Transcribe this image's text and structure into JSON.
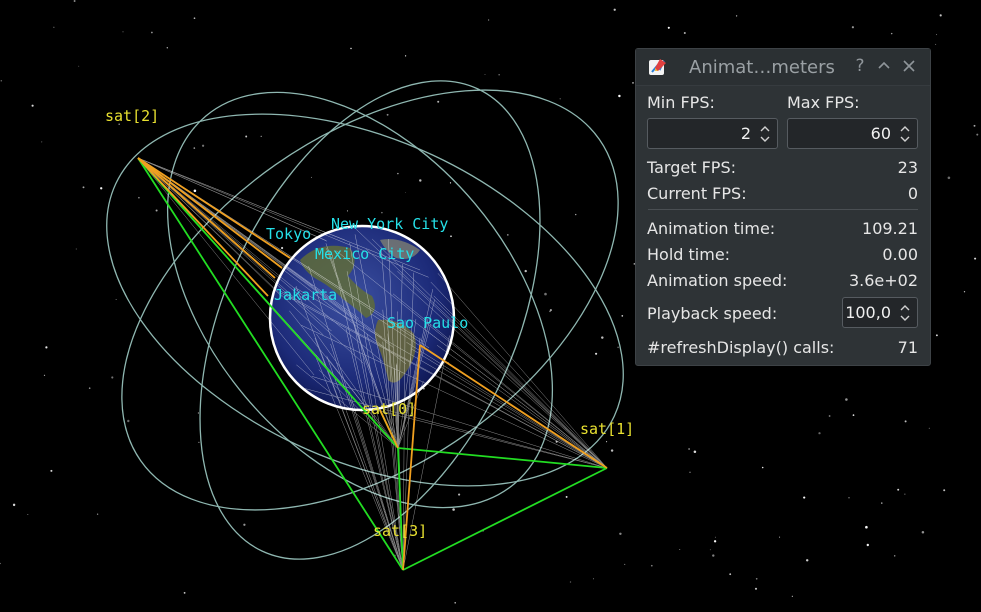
{
  "window": {
    "title": "Animat…meters",
    "help_icon": "question-icon",
    "minimize_icon": "chevron-up-icon",
    "close_icon": "close-icon"
  },
  "params": {
    "min_fps_label": "Min FPS:",
    "max_fps_label": "Max FPS:",
    "min_fps_value": "2",
    "max_fps_value": "60",
    "target_fps_label": "Target FPS:",
    "target_fps_value": "23",
    "current_fps_label": "Current FPS:",
    "current_fps_value": "0",
    "animation_time_label": "Animation time:",
    "animation_time_value": "109.21",
    "hold_time_label": "Hold time:",
    "hold_time_value": "0.00",
    "animation_speed_label": "Animation speed:",
    "animation_speed_value": "3.6e+02",
    "playback_speed_label": "Playback speed:",
    "playback_speed_value": "100,0",
    "refresh_calls_label": "#refreshDisplay() calls:",
    "refresh_calls_value": "71"
  },
  "scene": {
    "satellites": [
      "sat[2]",
      "sat[0]",
      "sat[1]",
      "sat[3]"
    ],
    "cities": [
      "Tokyo",
      "New York City",
      "Mexico City",
      "Jakarta",
      "Sao Paulo"
    ],
    "colors": {
      "orbit": "#a8d8d0",
      "sat_label": "#e8e030",
      "city_label": "#25e0e8",
      "link_green": "#22dd22",
      "link_orange": "#f0a020"
    }
  }
}
